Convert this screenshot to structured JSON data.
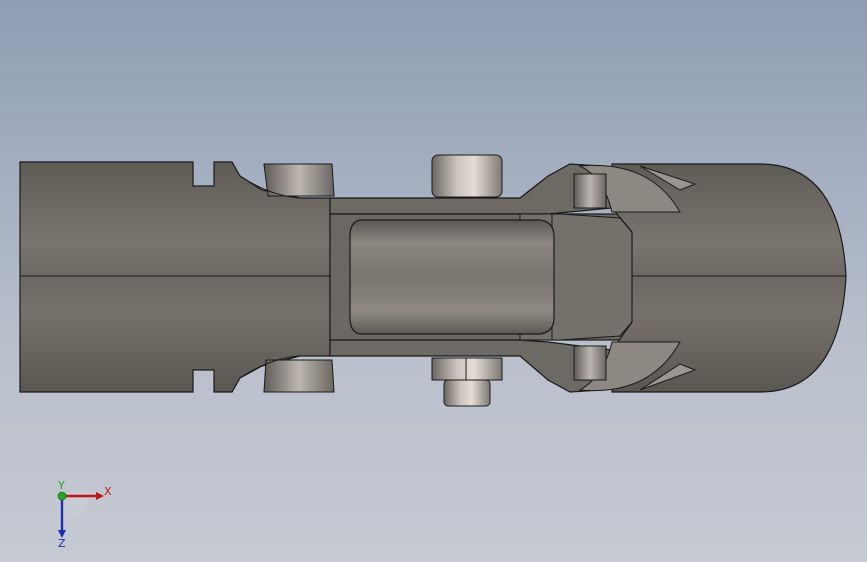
{
  "viewport": {
    "background_top": "#8f9cb2",
    "background_bottom": "#c6cad3"
  },
  "model": {
    "body_color": "#6f6b65",
    "edge_color": "#1a1a1a"
  },
  "triad": {
    "x_label": "X",
    "y_label": "Y",
    "z_label": "Z",
    "x_color": "#c0161a",
    "y_color": "#1faa1f",
    "z_color": "#1a2fb0"
  }
}
